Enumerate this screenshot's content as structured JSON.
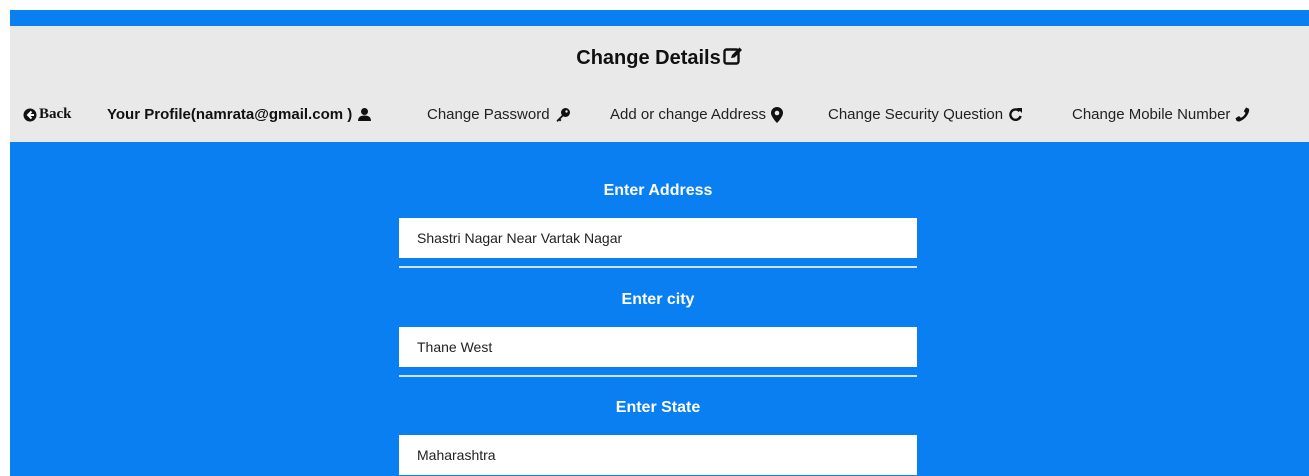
{
  "header": {
    "title": "Change Details",
    "title_icon": "edit-icon"
  },
  "nav": {
    "back_label": "Back",
    "profile_label": "Your Profile(namrata@gmail.com )",
    "change_password_label": "Change Password",
    "address_label": "Add or change Address",
    "security_question_label": "Change Security Question",
    "mobile_label": "Change Mobile Number"
  },
  "form": {
    "address": {
      "label": "Enter Address",
      "value": "Shastri Nagar Near Vartak Nagar"
    },
    "city": {
      "label": "Enter city",
      "value": "Thane West"
    },
    "state": {
      "label": "Enter State",
      "value": "Maharashtra"
    }
  },
  "colors": {
    "accent": "#0a7ff2",
    "header_bg": "#e9e9e9"
  }
}
